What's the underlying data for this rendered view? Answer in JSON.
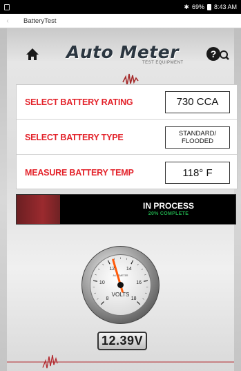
{
  "status_bar": {
    "battery_percent": "69%",
    "time": "8:43 AM"
  },
  "app_bar": {
    "title": "BatteryTest"
  },
  "header": {
    "logo_text": "Auto Meter",
    "logo_sub": "TEST EQUIPMENT"
  },
  "settings": [
    {
      "label": "SELECT BATTERY RATING",
      "value": "730 CCA"
    },
    {
      "label": "SELECT BATTERY TYPE",
      "value_line1": "STANDARD/",
      "value_line2": "FLOODED"
    },
    {
      "label": "MEASURE BATTERY TEMP",
      "value": "118° F"
    }
  ],
  "progress": {
    "title": "IN PROCESS",
    "subtitle": "20% COMPLETE",
    "fraction": 0.2
  },
  "gauge": {
    "label": "VOLTS",
    "brand": "AUTOMETER",
    "ticks": [
      "8",
      "10",
      "12",
      "14",
      "16",
      "18"
    ],
    "reading": 12.39
  },
  "voltage": {
    "display": "12.39V"
  },
  "colors": {
    "accent_red": "#e3222a",
    "progress_green": "#1fa84a",
    "progress_bar": "#9b2a2e"
  }
}
